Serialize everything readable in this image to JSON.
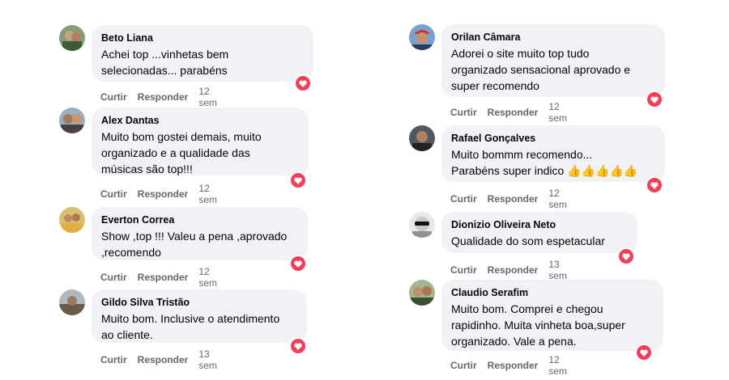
{
  "colors": {
    "bubble": "#f0f2f5",
    "heart": "#f33e58",
    "meta": "#65676b",
    "text": "#050505"
  },
  "actions": {
    "like": "Curtir",
    "reply": "Responder"
  },
  "comments": [
    {
      "author": "Beto Liana",
      "text": "Achei top ...vinhetas bem\nselecionadas... parabéns",
      "time": "12 sem",
      "reaction_icon": "heart-icon"
    },
    {
      "author": "Alex Dantas",
      "text": "Muito bom gostei demais, muito\norganizado e a qualidade das\nmúsicas são top!!!",
      "time": "12 sem",
      "reaction_icon": "heart-icon"
    },
    {
      "author": "Everton Correa",
      "text": "Show ,top !!! Valeu a pena ,aprovado\n,recomendo",
      "time": "12 sem",
      "reaction_icon": "heart-icon"
    },
    {
      "author": "Gildo Silva Tristão",
      "text": "Muito bom. Inclusive o atendimento\nao cliente.",
      "time": "13 sem",
      "reaction_icon": "heart-icon"
    },
    {
      "author": "Orilan Câmara",
      "text": "Adorei o site muito top tudo\norganizado sensacional aprovado e\nsuper recomendo",
      "time": "12 sem",
      "reaction_icon": "heart-icon"
    },
    {
      "author": "Rafael Gonçalves",
      "text": "Muito bommm recomendo...\nParabéns super indico 👍👍👍👍👍",
      "time": "12 sem",
      "reaction_icon": "heart-icon"
    },
    {
      "author": "Dionizio Oliveira Neto",
      "text": "Qualidade do som espetacular",
      "time": "13 sem",
      "reaction_icon": "heart-icon"
    },
    {
      "author": "Claudio Serafim",
      "text": "Muito bom. Comprei e chegou\nrapidinho. Muita vinheta boa,super\norganizado. Vale a pena.",
      "time": "12 sem",
      "reaction_icon": "heart-icon"
    }
  ]
}
